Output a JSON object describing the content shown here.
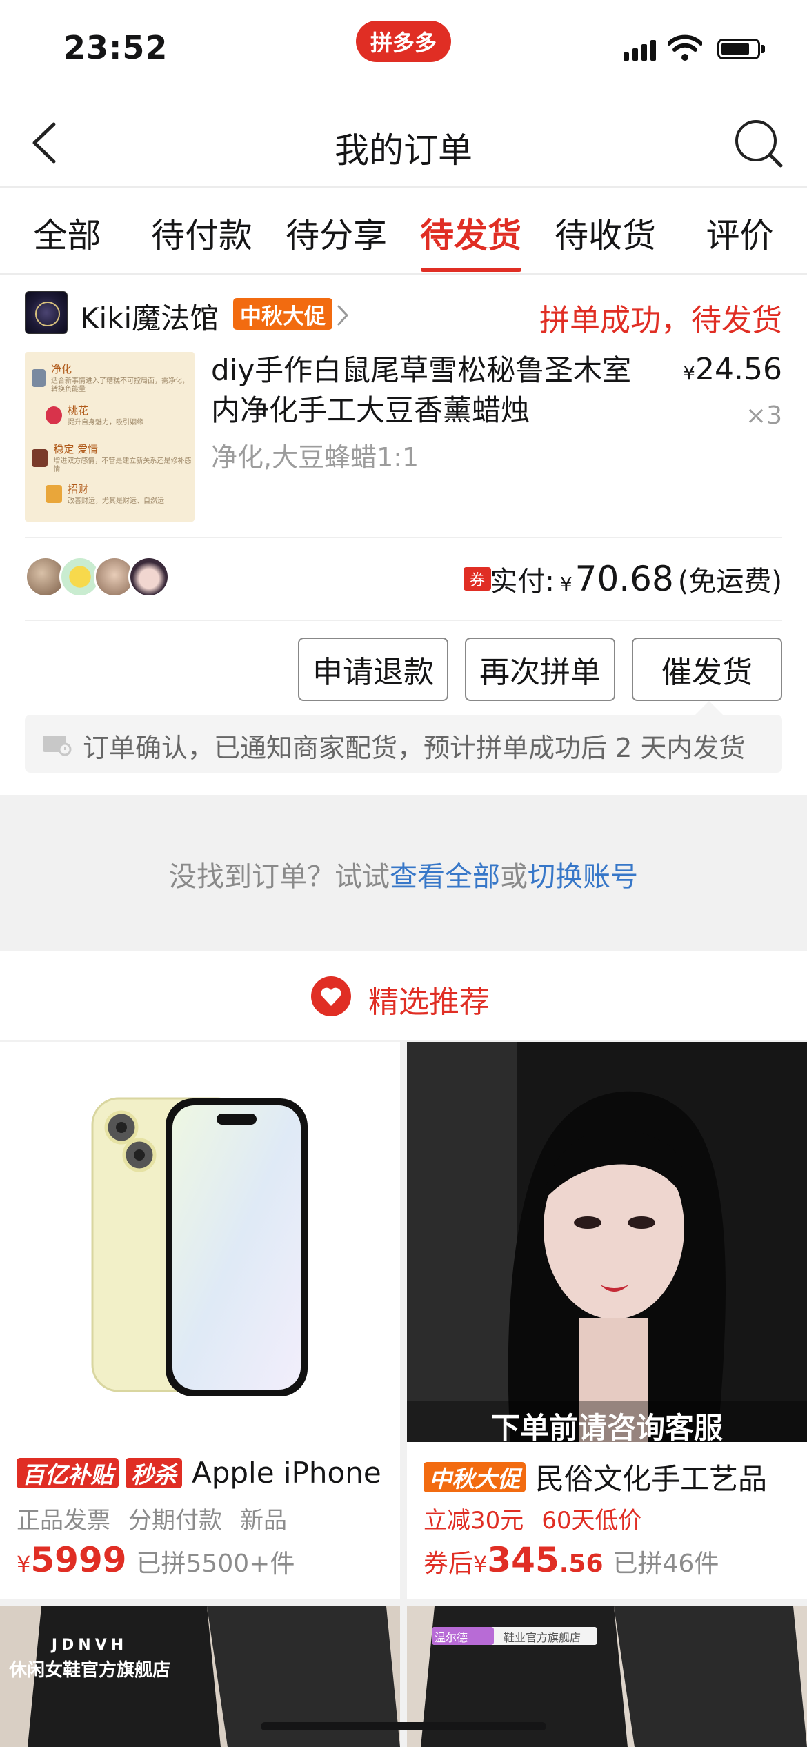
{
  "status_bar": {
    "time": "23:52",
    "app_badge": "拼多多"
  },
  "header": {
    "title": "我的订单"
  },
  "tabs": [
    {
      "label": "全部"
    },
    {
      "label": "待付款"
    },
    {
      "label": "待分享"
    },
    {
      "label": "待发货",
      "active": true
    },
    {
      "label": "待收货"
    },
    {
      "label": "评价"
    }
  ],
  "order": {
    "shop_name": "Kiki魔法馆",
    "promo_tag": "中秋大促",
    "status": "拼单成功，待发货",
    "product": {
      "title": "diy手作白鼠尾草雪松秘鲁圣木室内净化手工大豆香薰蜡烛",
      "spec": "净化,大豆蜂蜡1:1",
      "currency": "¥",
      "price": "24.56",
      "quantity": "×3",
      "image_rows": [
        {
          "title": "净化",
          "desc": "适合新事情进入了糟糕不可控局面，需净化，转换负能量"
        },
        {
          "title": "桃花",
          "desc": "提升自身魅力，吸引姻缘"
        },
        {
          "title": "稳定 爱情",
          "desc": "增进双方感情，不管是建立新关系还是修补感情"
        },
        {
          "title": "招财",
          "desc": "改善财运，尤其是财运、自然运"
        }
      ]
    },
    "coupon_tag": "券",
    "paid_label": "实付:",
    "paid_currency": "¥",
    "paid_amount": "70.68",
    "paid_note": "(免运费)",
    "buttons": {
      "refund": "申请退款",
      "reorder": "再次拼单",
      "urge": "催发货"
    },
    "notice": "订单确认，已通知商家配货，预计拼单成功后 2 天内发货"
  },
  "not_found": {
    "text": "没找到订单？试试",
    "link1": "查看全部",
    "or": "或",
    "link2": "切换账号"
  },
  "recommend": {
    "title": "精选推荐",
    "items": [
      {
        "tags": [
          "百亿补贴",
          "秒杀"
        ],
        "name": "Apple iPhone",
        "subs": [
          "正品发票",
          "分期付款",
          "新品"
        ],
        "prefix": "",
        "currency": "¥",
        "price": "5999",
        "sold": "已拼5500+件"
      },
      {
        "tags": [
          "中秋大促"
        ],
        "name": "民俗文化手工艺品",
        "subs": [
          "立减30元",
          "60天低价"
        ],
        "prefix": "券后",
        "currency": "¥",
        "price": "345",
        "price_decimal": ".56",
        "sold": "已拼46件",
        "overlay": "下单前请咨询客服"
      }
    ],
    "bottom_left_text": "JDNVH",
    "bottom_left_sub": "休闲女鞋官方旗舰店",
    "bottom_right_tag": "温尔德",
    "bottom_right_sub": "鞋业官方旗舰店"
  },
  "colors": {
    "accent": "#e02e24",
    "link": "#3777c8",
    "promo_orange": "#f26b10"
  }
}
